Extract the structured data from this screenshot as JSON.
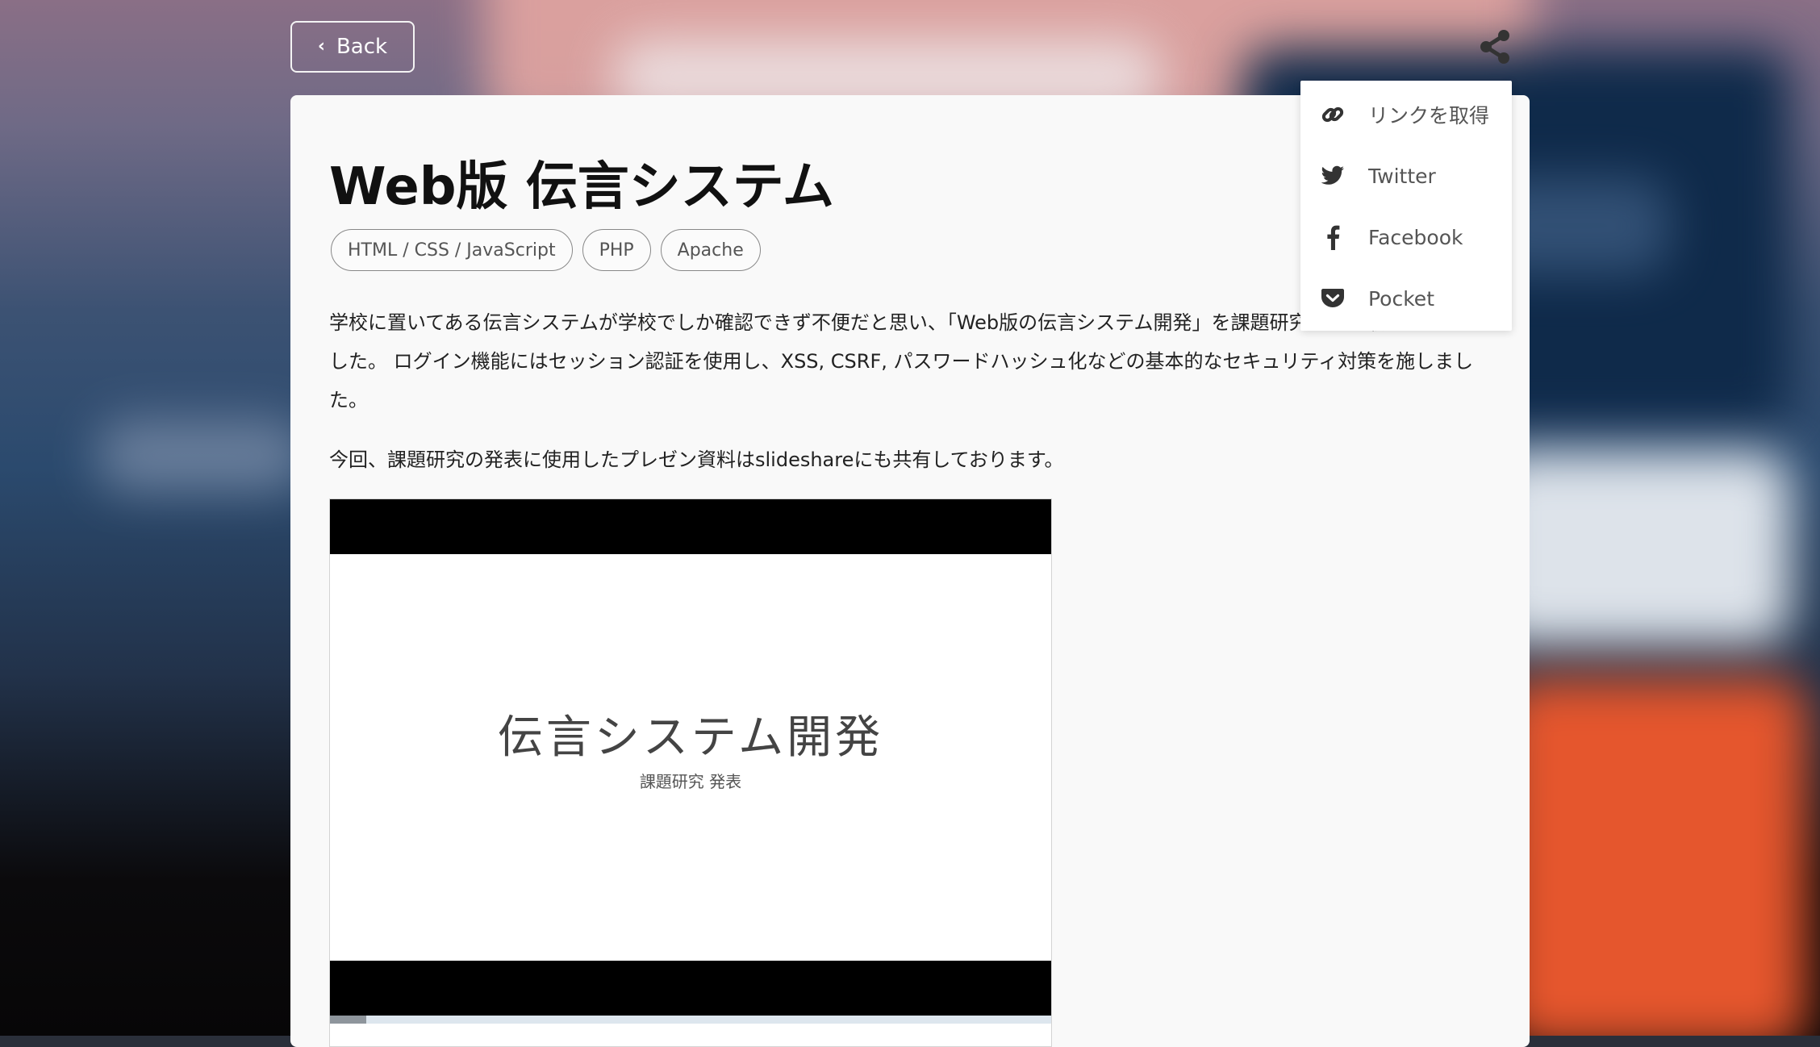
{
  "header": {
    "back_label": "Back"
  },
  "article": {
    "title": "Web版 伝言システム",
    "tags": [
      "HTML / CSS / JavaScript",
      "PHP",
      "Apache"
    ],
    "paragraph1": "学校に置いてある伝言システムが学校でしか確認できず不便だと思い、「Web版の伝言システム開発」を課題研究として取り組みました。 ログイン機能にはセッション認証を使用し、XSS, CSRF, パスワードハッシュ化などの基本的なセキュリティ対策を施しました。",
    "paragraph2": "今回、課題研究の発表に使用したプレゼン資料はslideshareにも共有しております。",
    "slide": {
      "title": "伝言システム開発",
      "subtitle": "課題研究 発表",
      "progress_fraction": 0.05
    }
  },
  "share_menu": {
    "items": [
      {
        "label": "リンクを取得",
        "icon": "link-icon"
      },
      {
        "label": "Twitter",
        "icon": "twitter-icon"
      },
      {
        "label": "Facebook",
        "icon": "facebook-icon"
      },
      {
        "label": "Pocket",
        "icon": "pocket-icon"
      }
    ]
  },
  "colors": {
    "card_bg": "#f9f9f9",
    "icon": "#333333",
    "slide_bar": "#000000"
  }
}
